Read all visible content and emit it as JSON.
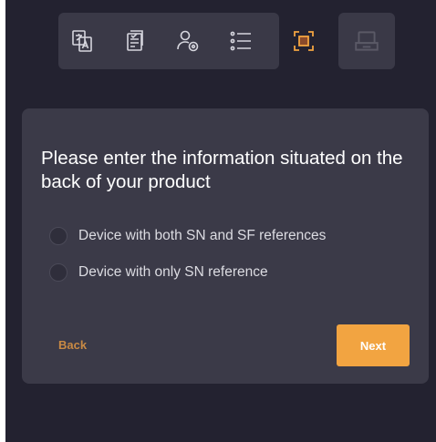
{
  "stepper": {
    "steps": [
      {
        "icon": "document-translate-icon",
        "state": "done"
      },
      {
        "icon": "document-edit-icon",
        "state": "done"
      },
      {
        "icon": "user-settings-icon",
        "state": "done"
      },
      {
        "icon": "list-icon",
        "state": "done"
      },
      {
        "icon": "scan-frame-icon",
        "state": "active"
      },
      {
        "icon": "package-icon",
        "state": "disabled"
      }
    ],
    "colors": {
      "done": "#d6d6de",
      "active": "#f2a441",
      "disabled": "#5a5966"
    }
  },
  "dialog": {
    "title": "Please enter the information situated on the back of your product",
    "options": [
      {
        "label": "Device with both SN and SF references",
        "selected": false
      },
      {
        "label": "Device with only SN reference",
        "selected": false
      }
    ],
    "back_label": "Back",
    "next_label": "Next"
  },
  "colors": {
    "background": "#232230",
    "card": "#3b3a48",
    "accent": "#f2a441",
    "back_text": "#c98a44"
  }
}
